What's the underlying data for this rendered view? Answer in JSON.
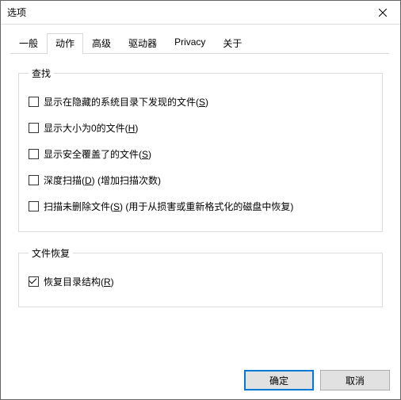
{
  "window": {
    "title": "选项"
  },
  "tabs": {
    "t0": "一般",
    "t1": "动作",
    "t2": "高级",
    "t3": "驱动器",
    "t4": "Privacy",
    "t5": "关于",
    "active_index": 1
  },
  "groups": {
    "search": {
      "legend": "查找",
      "items": {
        "show_hidden": {
          "label": "显示在隐藏的系统目录下发现的文件(",
          "accel": "S",
          "suffix": ")",
          "checked": false
        },
        "show_zero": {
          "label": "显示大小为0的文件(",
          "accel": "H",
          "suffix": ")",
          "checked": false
        },
        "show_overw": {
          "label": "显示安全覆盖了的文件(",
          "accel": "S",
          "suffix": ")",
          "checked": false
        },
        "deep_scan": {
          "label": "深度扫描(",
          "accel": "D",
          "suffix": ") (增加扫描次数)",
          "checked": false
        },
        "scan_undel": {
          "label": "扫描未删除文件(",
          "accel": "S",
          "suffix": ") (用于从损害或重新格式化的磁盘中恢复)",
          "checked": false
        }
      }
    },
    "recover": {
      "legend": "文件恢复",
      "items": {
        "restore_dir": {
          "label": "恢复目录结构(",
          "accel": "R",
          "suffix": ")",
          "checked": true
        }
      }
    }
  },
  "buttons": {
    "ok": "确定",
    "cancel": "取消"
  }
}
